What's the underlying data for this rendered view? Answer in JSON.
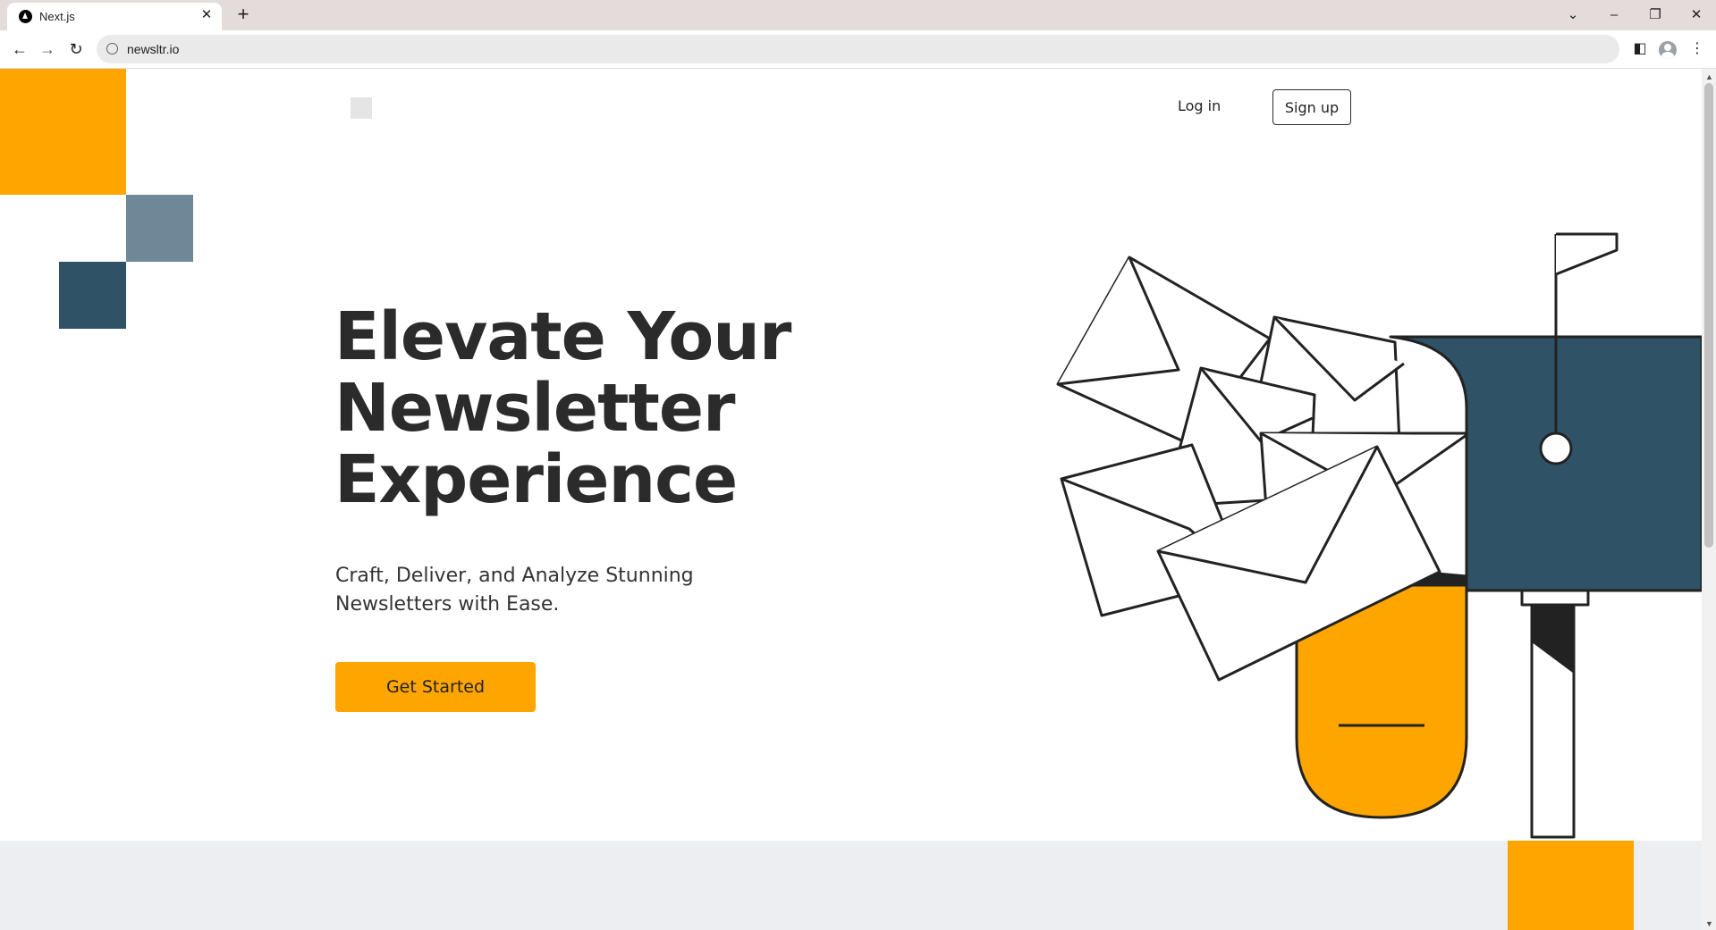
{
  "browser": {
    "tab_title": "Next.js",
    "tab_favicon": "nextjs-logo-icon",
    "url": "newsltr.io",
    "icons": [
      "back-arrow-icon",
      "forward-arrow-icon",
      "reload-icon",
      "site-info-icon",
      "sidebar-icon",
      "profile-icon",
      "kebab-menu-icon",
      "tab-search-icon",
      "minimize-icon",
      "restore-icon",
      "close-icon"
    ]
  },
  "nav": {
    "login_label": "Log in",
    "signup_label": "Sign up"
  },
  "hero": {
    "title_line1": "Elevate Your",
    "title_line2": "Newsletter",
    "title_line3": "Experience",
    "subtitle": "Craft, Deliver, and Analyze Stunning Newsletters with Ease.",
    "cta_label": "Get Started"
  },
  "colors": {
    "accent_orange": "#ffa500",
    "slate_light": "#6e8898",
    "slate_dark": "#2f5266",
    "text_dark": "#2b2b2b",
    "band_gray": "#eceef2"
  }
}
